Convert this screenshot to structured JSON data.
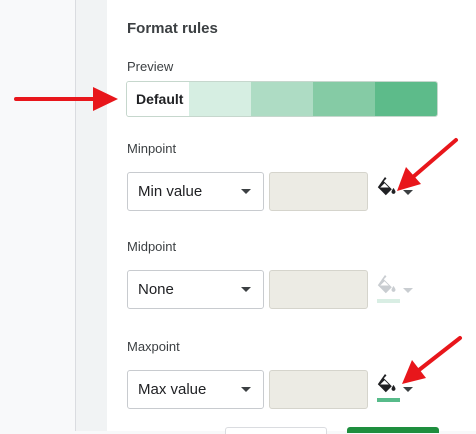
{
  "format_rules": {
    "title": "Format rules",
    "preview_label": "Preview",
    "preview_default": "Default",
    "preview_gradient": [
      "#d6eee2",
      "#aedcc4",
      "#85cba5",
      "#5dbb8a"
    ]
  },
  "minpoint": {
    "label": "Minpoint",
    "selected": "Min value",
    "value": "",
    "color": "#ffffff"
  },
  "midpoint": {
    "label": "Midpoint",
    "selected": "None",
    "value": "",
    "color": "#d9eee4"
  },
  "maxpoint": {
    "label": "Maxpoint",
    "selected": "Max value",
    "value": "",
    "color": "#57bb8a"
  },
  "colors": {
    "annotation_arrow": "#e8161b",
    "accent_green": "#1e8e3e"
  }
}
